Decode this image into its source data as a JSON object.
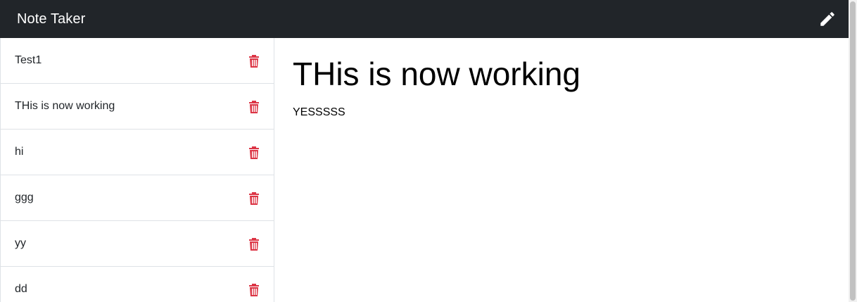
{
  "navbar": {
    "brand": "Note Taker",
    "edit_icon": "pencil-icon"
  },
  "sidebar": {
    "items": [
      {
        "title": "Test1",
        "icon": "trash-icon"
      },
      {
        "title": "THis is now working",
        "icon": "trash-icon"
      },
      {
        "title": "hi",
        "icon": "trash-icon"
      },
      {
        "title": "ggg",
        "icon": "trash-icon"
      },
      {
        "title": "yy",
        "icon": "trash-icon"
      },
      {
        "title": "dd",
        "icon": "trash-icon"
      }
    ]
  },
  "note": {
    "title": "THis is now working",
    "text": "YESSSSS"
  },
  "colors": {
    "navbar_bg": "#212529",
    "delete": "#dc3545"
  }
}
